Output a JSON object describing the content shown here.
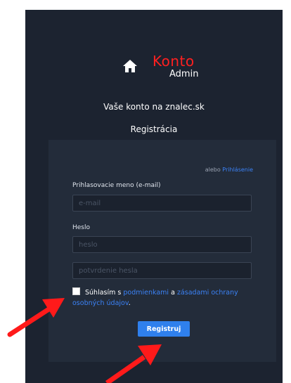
{
  "logo": {
    "title": "Konto",
    "subtitle": "Admin",
    "icon": "home-icon"
  },
  "page": {
    "heading": "Vaše konto na znalec.sk",
    "subheading": "Registrácia"
  },
  "login_link": {
    "prefix": "alebo",
    "label": "Prihlásenie"
  },
  "form": {
    "username_label": "Prihlasovacie meno (e-mail)",
    "email_placeholder": "e-mail",
    "password_label": "Heslo",
    "password_placeholder": "heslo",
    "confirm_placeholder": "potvrdenie hesla",
    "consent_prefix": "Súhlasím s",
    "terms_link": "podmienkami",
    "consent_and": "a",
    "privacy_link": "zásadami ochrany osobných údajov",
    "consent_suffix": ".",
    "checkbox_checked": false,
    "submit_label": "Registruj"
  },
  "colors": {
    "background": "#1c2330",
    "card": "#232c3a",
    "accent": "#2f80ed",
    "logo_red": "#ff2020",
    "annotation_arrow": "#ff1a1a"
  }
}
